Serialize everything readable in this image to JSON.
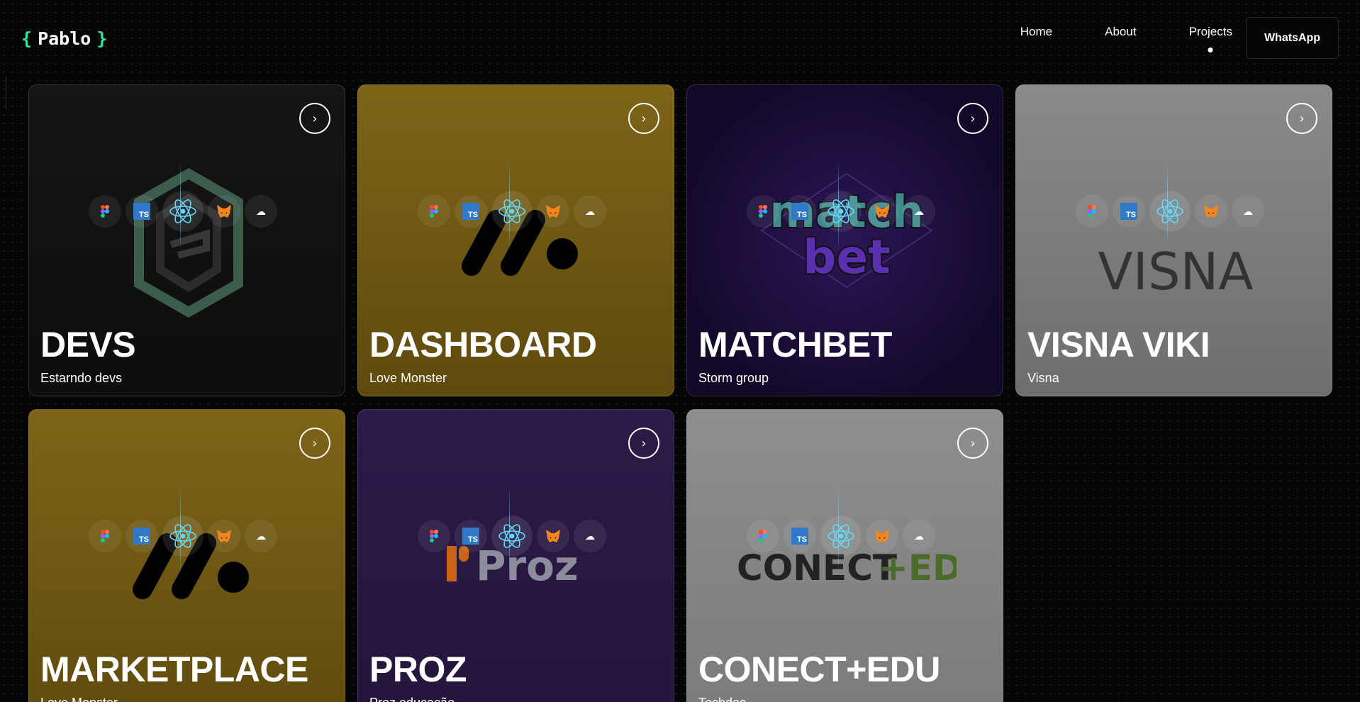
{
  "header": {
    "logo_open": "{",
    "logo_name": "Pablo",
    "logo_close": "}",
    "nav": [
      {
        "label": "Home"
      },
      {
        "label": "About"
      },
      {
        "label": "Projects",
        "active": true
      }
    ],
    "cta_label": "WhatsApp"
  },
  "colors": {
    "background": "#050505",
    "accent": "#2ee59d"
  },
  "tech_stack": [
    "figma-icon",
    "typescript-icon",
    "react-icon",
    "metamask-icon",
    "cloud-icon"
  ],
  "tech_ts_text": "TS",
  "projects": [
    {
      "title": "DEVS",
      "subtitle": "Estarndo devs",
      "bg": "#111111",
      "logo": "devs-hexagon-logo"
    },
    {
      "title": "DASHBOARD",
      "subtitle": "Love Monster",
      "bg": "#7a6014",
      "logo": "love-monster-logo"
    },
    {
      "title": "MATCHBET",
      "subtitle": "Storm group",
      "bg": "#1c0f38",
      "logo": "matchbet-logo"
    },
    {
      "title": "VISNA VIKI",
      "subtitle": "Visna",
      "bg": "#858585",
      "logo": "visna-logo",
      "logo_text": "VISNA"
    },
    {
      "title": "MARKETPLACE",
      "subtitle": "Love Monster",
      "bg": "#7a6014",
      "logo": "love-monster-logo"
    },
    {
      "title": "PROZ",
      "subtitle": "Proz educação",
      "bg": "#2a1945",
      "logo": "proz-logo",
      "logo_text": "Proz"
    },
    {
      "title": "CONECT+EDU",
      "subtitle": "Techdoc",
      "bg": "#8c8c8c",
      "logo": "conect-edu-logo",
      "logo_text_a": "CONECT",
      "logo_text_b": "+EDU"
    }
  ]
}
